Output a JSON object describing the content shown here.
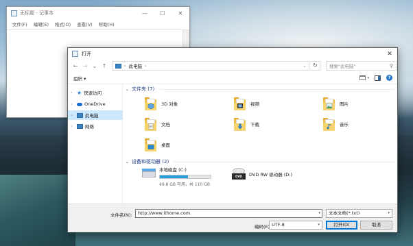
{
  "notepad": {
    "title": "无标题 - 记事本",
    "menu": [
      "文件(F)",
      "编辑(E)",
      "格式(O)",
      "查看(V)",
      "帮助(H)"
    ],
    "win_buttons": [
      "—",
      "☐",
      "✕"
    ]
  },
  "dialog": {
    "title": "打开",
    "close_icon": "✕",
    "address": {
      "location": "此电脑",
      "separator": "›",
      "chevron": "›",
      "dropdown": "⌄",
      "refresh": "↻"
    },
    "nav_buttons": [
      "←",
      "→",
      "⌄",
      "↑"
    ],
    "search_placeholder": "搜索\"此电脑\"",
    "search_icon": "⚲",
    "organize": "组织 ▾",
    "help_label": "?",
    "nav_items": [
      {
        "label": "快速访问",
        "icon": "star-icon"
      },
      {
        "label": "OneDrive",
        "icon": "cloud-icon"
      },
      {
        "label": "此电脑",
        "icon": "pc-icon",
        "selected": true
      },
      {
        "label": "网络",
        "icon": "network-icon"
      }
    ],
    "folders_header": "文件夹 (7)",
    "folders": [
      {
        "name": "3D 对象",
        "glyph": "3d"
      },
      {
        "name": "视频",
        "glyph": "video"
      },
      {
        "name": "图片",
        "glyph": "picture"
      },
      {
        "name": "文档",
        "glyph": "document"
      },
      {
        "name": "下载",
        "glyph": "download"
      },
      {
        "name": "音乐",
        "glyph": "music"
      },
      {
        "name": "桌面",
        "glyph": "desktop"
      }
    ],
    "devices_header": "设备和驱动器 (2)",
    "drives": [
      {
        "name": "本地磁盘 (C:)",
        "space": "49.8 GB 可用，共 110 GB",
        "used_fraction": 0.55
      },
      {
        "name": "DVD RW 驱动器 (D:)",
        "disc_label": "DVD"
      }
    ],
    "filename_label": "文件名(N):",
    "filename_value": "http://www.ithome.com",
    "filetype_value": "文本文档(*.txt)",
    "encoding_label": "编码(E):",
    "encoding_value": "UTF-8",
    "open_button": "打开(O)",
    "cancel_button": "取消"
  }
}
